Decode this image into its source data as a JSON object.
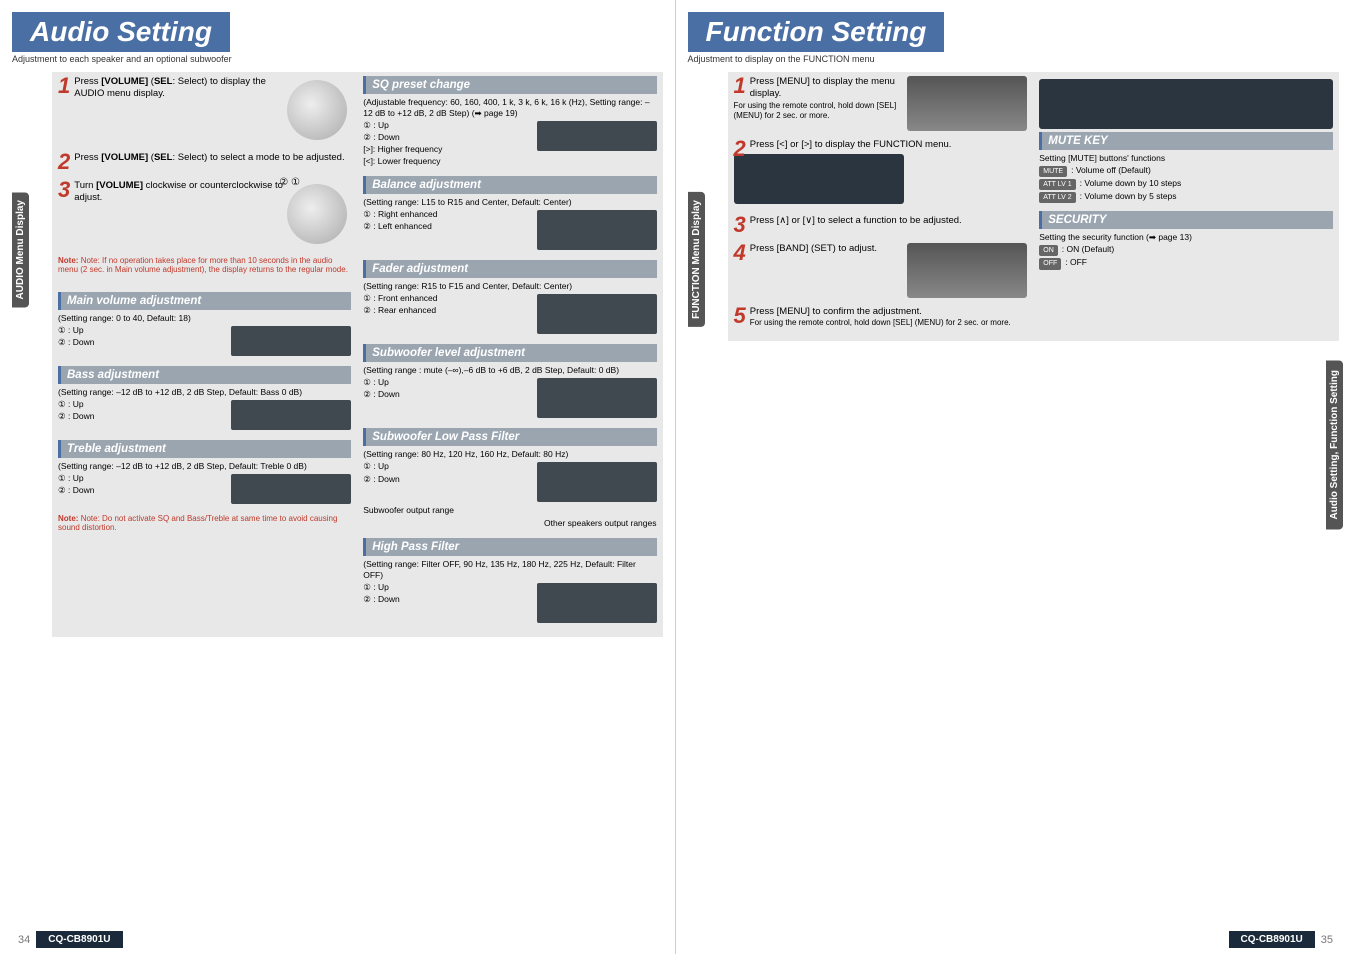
{
  "left_page": {
    "title": "Audio Setting",
    "subtitle": "Adjustment to each speaker and an optional subwoofer",
    "side_tab": "AUDIO Menu Display",
    "steps": [
      {
        "num": "1",
        "text_a": "Press ",
        "bold_a": "[VOLUME]",
        "text_b": " (",
        "bold_b": "SEL",
        "text_c": ": Select) to display the AUDIO menu display."
      },
      {
        "num": "2",
        "text_a": "Press ",
        "bold_a": "[VOLUME]",
        "text_b": " (",
        "bold_b": "SEL",
        "text_c": ": Select) to select a mode to be adjusted."
      },
      {
        "num": "3",
        "text_a": "Turn ",
        "bold_a": "[VOLUME]",
        "text_b": " clockwise or counterclockwise to adjust."
      }
    ],
    "note_steps": "Note: If no operation takes place for more than 10 seconds in the audio menu (2 sec. in Main volume adjustment), the display returns to the regular mode.",
    "main_volume": {
      "header": "Main volume adjustment",
      "range": "(Setting range: 0 to 40, Default: 18)",
      "opt1": "① : Up",
      "opt2": "② : Down"
    },
    "bass": {
      "header": "Bass adjustment",
      "range": "(Setting range: –12 dB to +12 dB, 2 dB Step, Default: Bass 0 dB)",
      "opt1": "① : Up",
      "opt2": "② : Down"
    },
    "treble": {
      "header": "Treble adjustment",
      "range": "(Setting range: –12 dB to +12 dB, 2 dB Step, Default: Treble 0 dB)",
      "opt1": "① : Up",
      "opt2": "② : Down",
      "note": "Note: Do not activate SQ and Bass/Treble at same time to avoid causing sound distortion."
    },
    "sq": {
      "header": "SQ preset change",
      "range": "(Adjustable frequency: 60, 160, 400, 1 k, 3 k, 6 k, 16 k (Hz), Setting range: –12 dB to +12 dB, 2 dB Step) (➡ page 19)",
      "opt1": "① : Up",
      "opt2": "② : Down",
      "opt3": "[>]: Higher frequency",
      "opt4": "[<]: Lower frequency"
    },
    "balance": {
      "header": "Balance adjustment",
      "range": "(Setting range: L15 to R15 and Center, Default: Center)",
      "opt1": "① : Right enhanced",
      "opt2": "② : Left enhanced"
    },
    "fader": {
      "header": "Fader adjustment",
      "range": "(Setting range: R15 to F15 and Center, Default: Center)",
      "opt1": "① : Front enhanced",
      "opt2": "② : Rear enhanced"
    },
    "subwoofer": {
      "header": "Subwoofer level adjustment",
      "range": "(Setting range : mute (–∞),–6 dB to +6 dB, 2 dB Step, Default: 0 dB)",
      "opt1": "① : Up",
      "opt2": "② : Down"
    },
    "sublpf": {
      "header": "Subwoofer Low Pass Filter",
      "range": "(Setting range: 80 Hz, 120 Hz, 160 Hz, Default: 80 Hz)",
      "opt1": "① : Up",
      "opt2": "② : Down",
      "caption1": "Subwoofer output range",
      "caption2": "Other speakers output ranges"
    },
    "hpf": {
      "header": "High Pass Filter",
      "range": "(Setting range: Filter OFF, 90 Hz, 135 Hz, 180 Hz, 225 Hz, Default: Filter OFF)",
      "opt1": "① : Up",
      "opt2": "② : Down"
    },
    "page_num": "34",
    "model": "CQ-CB8901U"
  },
  "right_page": {
    "title": "Function Setting",
    "subtitle": "Adjustment to display on the FUNCTION menu",
    "side_tab": "FUNCTION Menu Display",
    "right_side_tab": "Audio Setting, Function Setting",
    "steps": [
      {
        "num": "1",
        "text": "Press [MENU] to display the menu display.",
        "sub": "For using the remote control, hold down [SEL] (MENU) for 2 sec. or more."
      },
      {
        "num": "2",
        "text": "Press [<] or [>] to display the FUNCTION menu."
      },
      {
        "num": "3",
        "text": "Press [∧] or [∨] to select a function to be adjusted."
      },
      {
        "num": "4",
        "text": "Press [BAND] (SET) to adjust."
      },
      {
        "num": "5",
        "text": "Press [MENU] to confirm the adjustment.",
        "sub": "For using the remote control, hold down [SEL] (MENU) for 2 sec. or more."
      }
    ],
    "mute": {
      "header": "MUTE KEY",
      "desc": "Setting [MUTE] buttons' functions",
      "opt1_label": "MUTE",
      "opt1_text": ": Volume off (Default)",
      "opt2_label": "ATT LV 1",
      "opt2_text": ": Volume down by 10 steps",
      "opt3_label": "ATT LV 2",
      "opt3_text": ": Volume down by 5 steps"
    },
    "security": {
      "header": "SECURITY",
      "desc": "Setting the security function (➡ page 13)",
      "opt1_label": "ON",
      "opt1_text": ": ON (Default)",
      "opt2_label": "OFF",
      "opt2_text": ": OFF"
    },
    "page_num": "35",
    "model": "CQ-CB8901U"
  }
}
